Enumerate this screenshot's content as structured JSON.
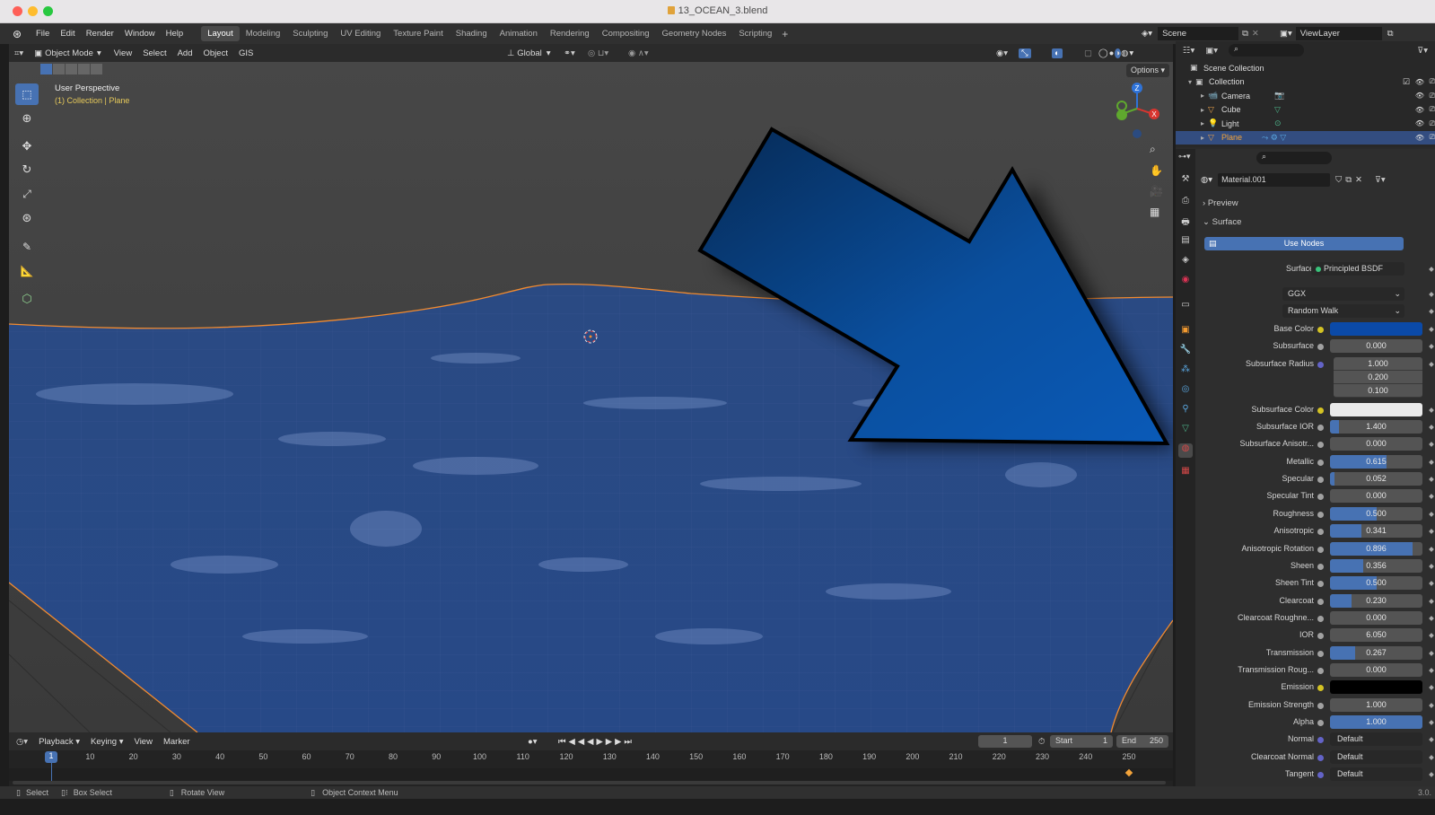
{
  "window": {
    "title": "13_OCEAN_3.blend"
  },
  "menu": {
    "items": [
      "File",
      "Edit",
      "Render",
      "Window",
      "Help"
    ]
  },
  "workspaces": [
    {
      "label": "Layout",
      "active": true
    },
    {
      "label": "Modeling"
    },
    {
      "label": "Sculpting"
    },
    {
      "label": "UV Editing"
    },
    {
      "label": "Texture Paint"
    },
    {
      "label": "Shading"
    },
    {
      "label": "Animation"
    },
    {
      "label": "Rendering"
    },
    {
      "label": "Compositing"
    },
    {
      "label": "Geometry Nodes"
    },
    {
      "label": "Scripting"
    }
  ],
  "scene": {
    "name": "Scene",
    "view_layer": "ViewLayer"
  },
  "viewport_header": {
    "mode": "Object Mode",
    "menus": [
      "View",
      "Select",
      "Add",
      "Object",
      "GIS"
    ],
    "orientation": "Global",
    "options": "Options"
  },
  "viewport": {
    "view_name": "User Perspective",
    "collection_info": "(1) Collection | Plane",
    "gizmo_axes": {
      "z": "Z",
      "x": "X"
    }
  },
  "outliner": {
    "items": [
      {
        "label": "Scene Collection"
      },
      {
        "label": "Collection"
      },
      {
        "label": "Camera"
      },
      {
        "label": "Cube"
      },
      {
        "label": "Light"
      },
      {
        "label": "Plane",
        "selected": true
      }
    ]
  },
  "properties": {
    "material_name": "Material.001",
    "panels": {
      "preview": "Preview",
      "surface": "Surface"
    },
    "use_nodes": "Use Nodes",
    "surface_label": "Surface",
    "surface_shader": "Principled BSDF",
    "distribution": "GGX",
    "subsurface_method": "Random Walk",
    "rows": [
      {
        "label": "Base Color",
        "type": "color",
        "color": "#0b4aa8",
        "socket": "#d4c324"
      },
      {
        "label": "Subsurface",
        "value": "0.000",
        "fill": 0
      },
      {
        "label": "Subsurface Radius",
        "type": "vec",
        "values": [
          "1.000",
          "0.200",
          "0.100"
        ],
        "socket": "#6363c7"
      },
      {
        "label": "Subsurface Color",
        "type": "color",
        "color": "#eaeaea",
        "socket": "#d4c324"
      },
      {
        "label": "Subsurface IOR",
        "value": "1.400",
        "fill": 0.1
      },
      {
        "label": "Subsurface Anisotr...",
        "value": "0.000",
        "fill": 0
      },
      {
        "label": "Metallic",
        "value": "0.615",
        "fill": 0.615
      },
      {
        "label": "Specular",
        "value": "0.052",
        "fill": 0.052
      },
      {
        "label": "Specular Tint",
        "value": "0.000",
        "fill": 0
      },
      {
        "label": "Roughness",
        "value": "0.500",
        "fill": 0.5
      },
      {
        "label": "Anisotropic",
        "value": "0.341",
        "fill": 0.341
      },
      {
        "label": "Anisotropic Rotation",
        "value": "0.896",
        "fill": 0.896
      },
      {
        "label": "Sheen",
        "value": "0.356",
        "fill": 0.356
      },
      {
        "label": "Sheen Tint",
        "value": "0.500",
        "fill": 0.5
      },
      {
        "label": "Clearcoat",
        "value": "0.230",
        "fill": 0.23
      },
      {
        "label": "Clearcoat Roughne...",
        "value": "0.000",
        "fill": 0
      },
      {
        "label": "IOR",
        "value": "6.050",
        "fill": 0
      },
      {
        "label": "Transmission",
        "value": "0.267",
        "fill": 0.267
      },
      {
        "label": "Transmission Roug...",
        "value": "0.000",
        "fill": 0
      },
      {
        "label": "Emission",
        "type": "color",
        "color": "#000000",
        "socket": "#d4c324"
      },
      {
        "label": "Emission Strength",
        "value": "1.000",
        "fill": 0
      },
      {
        "label": "Alpha",
        "value": "1.000",
        "fill": 1
      },
      {
        "label": "Normal",
        "type": "link",
        "value": "Default",
        "socket": "#6363c7"
      },
      {
        "label": "Clearcoat Normal",
        "type": "link",
        "value": "Default",
        "socket": "#6363c7"
      },
      {
        "label": "Tangent",
        "type": "link",
        "value": "Default",
        "socket": "#6363c7"
      }
    ]
  },
  "timeline": {
    "menus": [
      "Playback",
      "Keying",
      "View",
      "Marker"
    ],
    "current_frame": "1",
    "start_label": "Start",
    "start": "1",
    "end_label": "End",
    "end": "250",
    "ticks": [
      "10",
      "20",
      "30",
      "40",
      "50",
      "60",
      "70",
      "80",
      "90",
      "100",
      "110",
      "120",
      "130",
      "140",
      "150",
      "160",
      "170",
      "180",
      "190",
      "200",
      "210",
      "220",
      "230",
      "240",
      "250"
    ]
  },
  "status": {
    "select": "Select",
    "box_select": "Box Select",
    "rotate": "Rotate View",
    "context": "Object Context Menu",
    "version": "3.0."
  },
  "colors": {
    "accent": "#4772b3",
    "selection_orange": "#f28b30",
    "water": "#2c4f8e",
    "arrow": "#0a58b5"
  }
}
